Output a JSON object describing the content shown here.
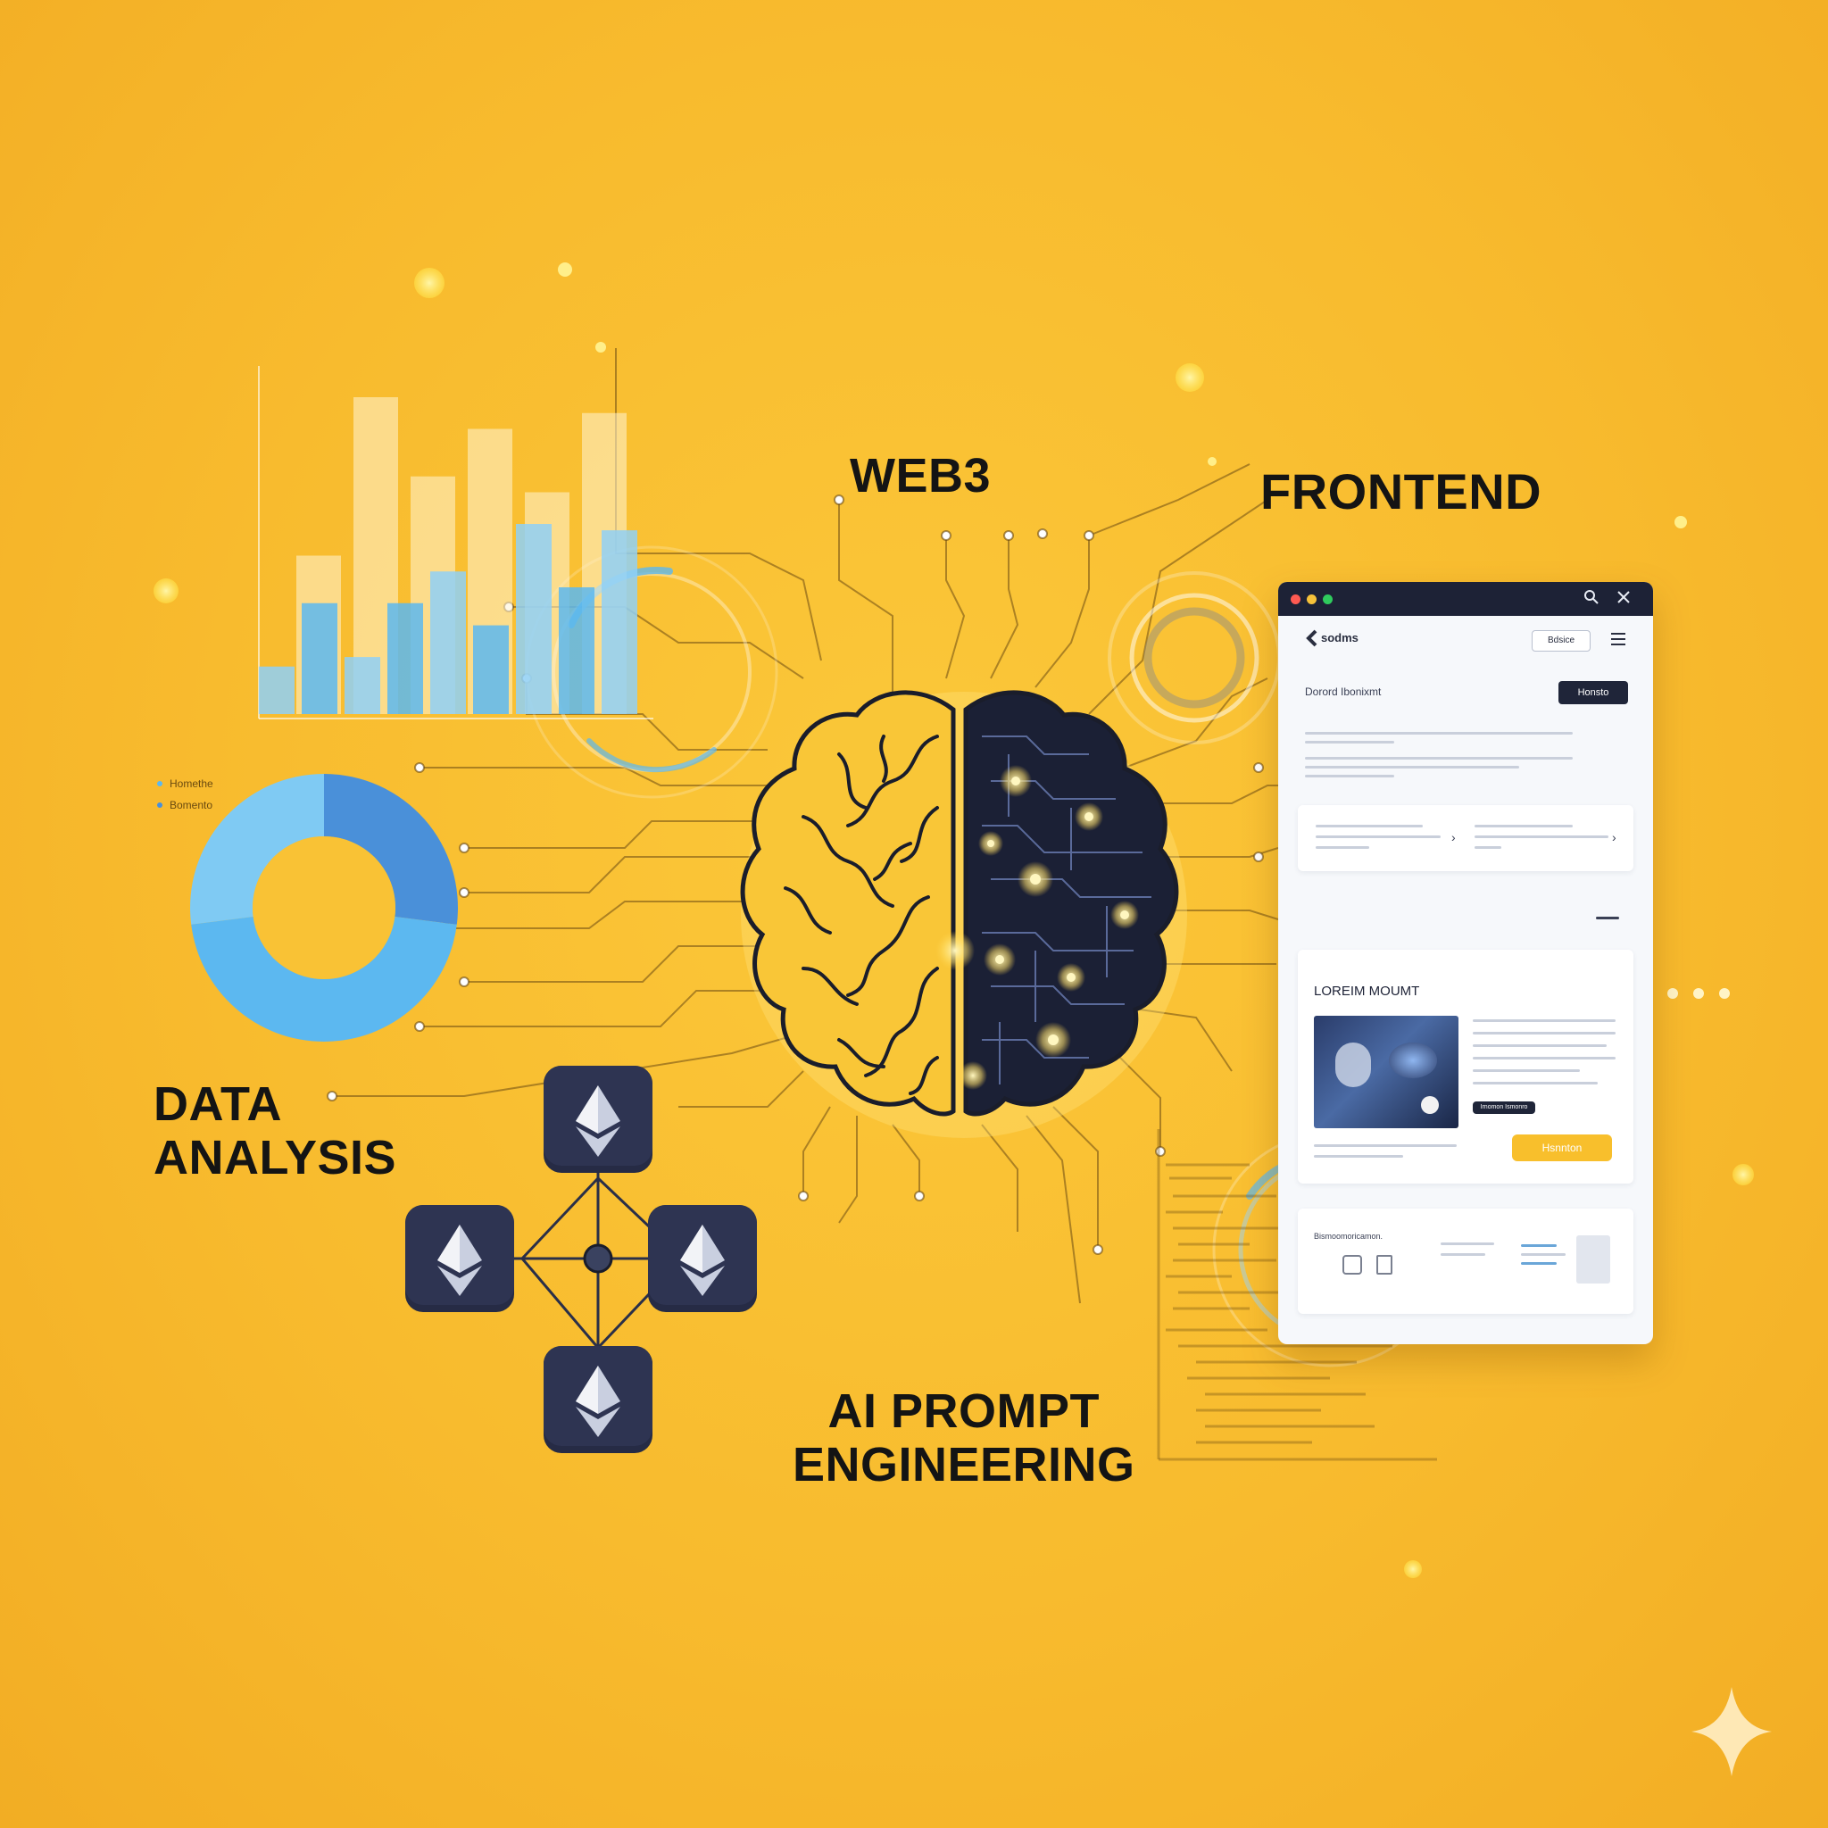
{
  "labels": {
    "web3": "WEB3",
    "frontend": "FRONTEND",
    "data_analysis_line1": "DATA",
    "data_analysis_line2": "ANALYSIS",
    "ai_line1": "AI PROMPT",
    "ai_line2": "ENGINEERING"
  },
  "donut_legend": [
    "Homethe",
    "Bomento"
  ],
  "bar_chart": {
    "front_values": [
      0.15,
      0.35,
      0.18,
      0.35,
      0.45,
      0.28,
      0.6,
      0.4,
      0.58
    ],
    "back_values": [
      0.5,
      1.0,
      0.75,
      0.9,
      0.7,
      0.95
    ]
  },
  "donut": {
    "segments": [
      {
        "value": 0.27,
        "color": "#4a90d9"
      },
      {
        "value": 0.46,
        "color": "#5cb8f0"
      },
      {
        "value": 0.27,
        "color": "#7fcaf3"
      }
    ]
  },
  "browser": {
    "nav_title": "sodms",
    "nav_button": "Bdsice",
    "headline": "Dorord Ibonixmt",
    "headline_button": "Honsto",
    "section_title": "LOREIM MOUMT",
    "cta_button": "Hsnnton",
    "small_button": "Irnomon Ismonro",
    "footer_caption": "Bismoomoricamon."
  },
  "colors": {
    "background": "#f8bb2e",
    "brain_outline": "#1a1d2b",
    "brain_dark": "#1b2035",
    "glow": "#ffd34d",
    "eth_tile": "#262b45",
    "accent_blue": "#5cb8f0"
  },
  "icons": [
    "ethereum-icon",
    "search-icon",
    "close-icon",
    "menu-icon",
    "back-chevron-icon",
    "sparkle-icon"
  ]
}
